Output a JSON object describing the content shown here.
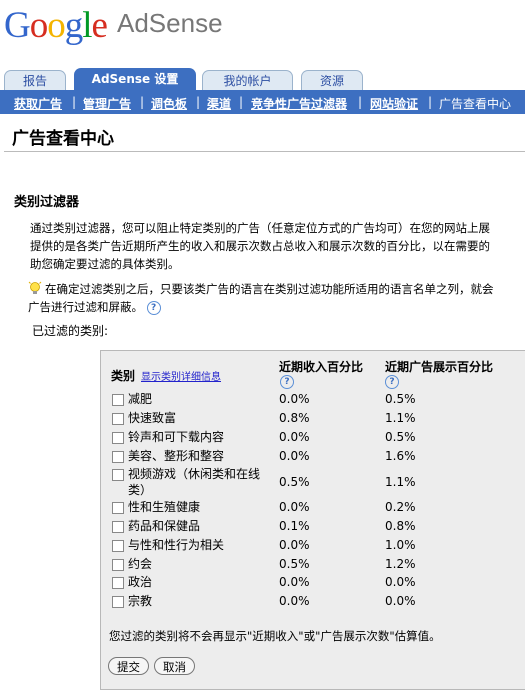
{
  "logo": {
    "google": "Google",
    "product": "AdSense",
    "colors": [
      "#3366cc",
      "#d62d20",
      "#f4b400",
      "#3366cc",
      "#009925",
      "#d62d20"
    ]
  },
  "tabs": [
    {
      "label": "报告"
    },
    {
      "label": "AdSense 设置"
    },
    {
      "label": "我的帐户"
    },
    {
      "label": "资源"
    }
  ],
  "subnav": [
    "获取广告",
    "管理广告",
    "调色板",
    "渠道",
    "竞争性广告过滤器",
    "网站验证",
    "广告查看中心"
  ],
  "page_title": "广告查看中心",
  "section_title": "类别过滤器",
  "description": [
    "通过类别过滤器，您可以阻止特定类别的广告（任意定位方式的广告均可）在您的网站上展",
    "提供的是各类广告近期所产生的收入和展示次数占总收入和展示次数的百分比，以在需要的",
    "助您确定要过滤的具体类别。"
  ],
  "tip": [
    "在确定过滤类别之后，只要该类广告的语言在类别过滤功能所适用的语言名单之列，就会",
    "广告进行过滤和屏蔽。"
  ],
  "help_glyph": "?",
  "filtered_label": "已过滤的类别:",
  "table": {
    "col_category": "类别",
    "col_category_link": "显示类别详细信息",
    "col_revenue": "近期收入百分比",
    "col_impressions": "近期广告展示百分比",
    "rows": [
      {
        "name": "减肥",
        "revenue": "0.0%",
        "impressions": "0.5%"
      },
      {
        "name": "快速致富",
        "revenue": "0.8%",
        "impressions": "1.1%"
      },
      {
        "name": "铃声和可下载内容",
        "revenue": "0.0%",
        "impressions": "0.5%"
      },
      {
        "name": "美容、整形和整容",
        "revenue": "0.0%",
        "impressions": "1.6%"
      },
      {
        "name": "视频游戏（休闲类和在线",
        "name2": "类）",
        "revenue": "0.5%",
        "impressions": "1.1%"
      },
      {
        "name": "性和生殖健康",
        "revenue": "0.0%",
        "impressions": "0.2%"
      },
      {
        "name": "药品和保健品",
        "revenue": "0.1%",
        "impressions": "0.8%"
      },
      {
        "name": "与性和性行为相关",
        "revenue": "0.0%",
        "impressions": "1.0%"
      },
      {
        "name": "约会",
        "revenue": "0.5%",
        "impressions": "1.2%"
      },
      {
        "name": "政治",
        "revenue": "0.0%",
        "impressions": "0.0%"
      },
      {
        "name": "宗教",
        "revenue": "0.0%",
        "impressions": "0.0%"
      }
    ],
    "note": "您过滤的类别将不会再显示\"近期收入\"或\"广告展示次数\"估算值。"
  },
  "buttons": {
    "submit": "提交",
    "cancel": "取消"
  }
}
